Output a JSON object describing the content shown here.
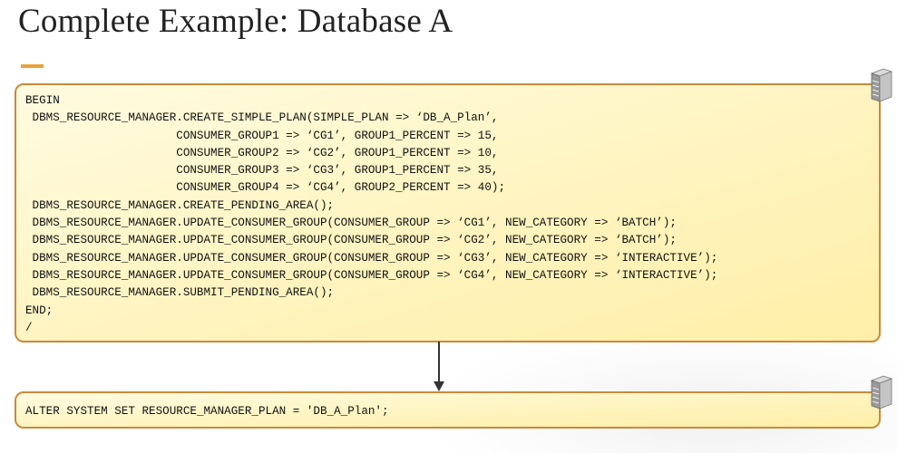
{
  "title": "Complete Example: Database A",
  "colors": {
    "accent": "#e8a23a",
    "box_border": "#c98a3a",
    "box_fill": "#fff4bf",
    "arrow": "#333333"
  },
  "icons": {
    "database_server": "server-icon"
  },
  "plsql_block": {
    "lines": [
      "BEGIN",
      " DBMS_RESOURCE_MANAGER.CREATE_SIMPLE_PLAN(SIMPLE_PLAN => ‘DB_A_Plan’,",
      "                      CONSUMER_GROUP1 => ‘CG1’, GROUP1_PERCENT => 15,",
      "                      CONSUMER_GROUP2 => ‘CG2’, GROUP1_PERCENT => 10,",
      "                      CONSUMER_GROUP3 => ‘CG3’, GROUP1_PERCENT => 35,",
      "                      CONSUMER_GROUP4 => ‘CG4’, GROUP2_PERCENT => 40);",
      " DBMS_RESOURCE_MANAGER.CREATE_PENDING_AREA();",
      " DBMS_RESOURCE_MANAGER.UPDATE_CONSUMER_GROUP(CONSUMER_GROUP => ‘CG1’, NEW_CATEGORY => ‘BATCH’);",
      " DBMS_RESOURCE_MANAGER.UPDATE_CONSUMER_GROUP(CONSUMER_GROUP => ‘CG2’, NEW_CATEGORY => ‘BATCH’);",
      " DBMS_RESOURCE_MANAGER.UPDATE_CONSUMER_GROUP(CONSUMER_GROUP => ‘CG3’, NEW_CATEGORY => ‘INTERACTIVE’);",
      " DBMS_RESOURCE_MANAGER.UPDATE_CONSUMER_GROUP(CONSUMER_GROUP => ‘CG4’, NEW_CATEGORY => ‘INTERACTIVE’);",
      " DBMS_RESOURCE_MANAGER.SUBMIT_PENDING_AREA();",
      "END;",
      "/"
    ]
  },
  "alter_statement": "ALTER SYSTEM SET RESOURCE_MANAGER_PLAN = 'DB_A_Plan';"
}
